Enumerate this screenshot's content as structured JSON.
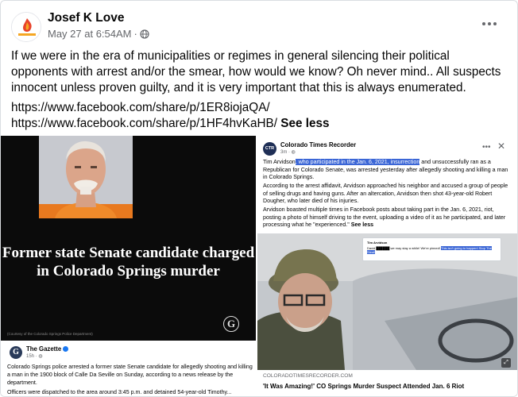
{
  "post": {
    "author": "Josef K Love",
    "timestamp": "May 27 at 6:54AM",
    "separator": "·",
    "avatar_text": "LOVE LETTER",
    "body": "If we were in the era of municipalities or regimes in general silencing their political opponents with arrest and/or the smear, how would we know?  Oh never mind..  All suspects innocent unless proven guilty, and it is very important that this is always enumerated.",
    "link1": "https://www.facebook.com/share/p/1ER8iojaQA/",
    "link2": "https://www.facebook.com/share/p/1HF4hvKaHB/",
    "see_less": "See less"
  },
  "left_media": {
    "headline": "Former state Senate candidate charged in Colorado Springs murder",
    "logo_letter": "G",
    "photo_credit": "(Courtesy of the Colorado Springs Police Department)",
    "source_name": "The Gazette",
    "source_time": "15h · ",
    "text": "Colorado Springs police arrested a former state Senate candidate for allegedly shooting and killing a man in the 1900 block of Calle Da Seville on Sunday, according to a news release by the department.",
    "text_cut": "Officers were dispatched to the area around 3:45 p.m. and detained 54-year-old Timothy..."
  },
  "right_media": {
    "avatar_text": "CTR",
    "source_name": "Colorado Times Recorder",
    "source_time": "3m · ",
    "p1_pre": "Tim Arvidson",
    "p1_hl": ", who participated in the Jan. 6, 2021, insurrection",
    "p1_post": " and unsuccessfully ran as a Republican for Colorado Senate, was arrested yesterday after allegedly shooting and killing a man in Colorado Springs.",
    "p2": "According to the arrest affidavit, Arvidson approached his neighbor and accused a group of people of selling drugs and having guns. After an altercation, Arvidson then shot 43-year-old Robert Dougher, who later died of his injuries.",
    "p3": "Arvidson boasted multiple times in Facebook posts about taking part in the Jan. 6, 2021, riot, posting a photo of himself driving to the event, uploading a video of it as he participated, and later processing what he \"experienced.\" ",
    "see_more": "See less",
    "inset_name": "Tim Arvidson",
    "inset_text": "David ██████ we may stay a while! We're pinned! ",
    "inset_hl": "This isn't going to happen! Stop The Steal!",
    "link_domain": "COLORADOTIMESRECORDER.COM",
    "link_title": "'It Was Amazing!' CO Springs Murder Suspect Attended Jan. 6 Riot"
  }
}
